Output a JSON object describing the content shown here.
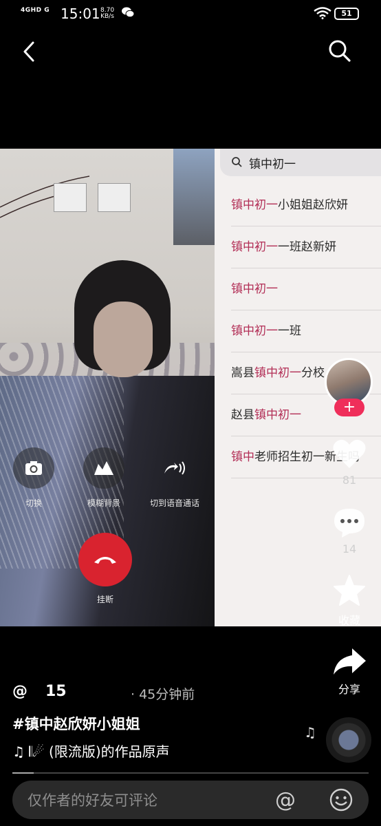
{
  "status_bar": {
    "network": "4GHD G",
    "time": "15:01",
    "speed_value": "8.70",
    "speed_unit": "KB/s",
    "battery": "51"
  },
  "top_nav": {
    "back_icon": "chevron-left-icon",
    "search_icon": "search-icon"
  },
  "video": {
    "call_controls": [
      {
        "label": "切换",
        "icon": "camera-switch-icon"
      },
      {
        "label": "模糊背景",
        "icon": "blur-background-icon"
      },
      {
        "label": "切到语音通话",
        "icon": "voice-call-icon"
      }
    ],
    "hangup_label": "挂断",
    "search_panel": {
      "query": "镇中初一",
      "suggestions": [
        {
          "pre": "",
          "hl": "镇中初一",
          "post": "小姐姐赵欣妍"
        },
        {
          "pre": "",
          "hl": "镇中初一",
          "post": "一班赵新妍"
        },
        {
          "pre": "",
          "hl": "镇中初一",
          "post": ""
        },
        {
          "pre": "",
          "hl": "镇中初一",
          "post": "一班"
        },
        {
          "pre": "嵩县",
          "hl": "镇中初一",
          "post": "分校"
        },
        {
          "pre": "赵县",
          "hl": "镇中初一",
          "post": ""
        },
        {
          "pre": "",
          "hl": "镇中",
          "post": "老师招生初一新生吗"
        }
      ]
    }
  },
  "rail": {
    "likes": "81",
    "comments": "14",
    "favorite_label": "收藏",
    "share_label": "分享",
    "follow_symbol": "+"
  },
  "post": {
    "author_prefix": "@",
    "author_name": "15",
    "time_ago": "· 45分钟前",
    "title": "#镇中赵欣妍小姐姐",
    "music": "♫ 𝄃☄ (限流版)的作品原声",
    "progress": 0.06
  },
  "comment_box": {
    "placeholder": "仅作者的好友可评论",
    "value": ""
  },
  "colors": {
    "highlight": "#b22e56",
    "hangup": "#d9232f",
    "follow": "#ef2e5a"
  }
}
